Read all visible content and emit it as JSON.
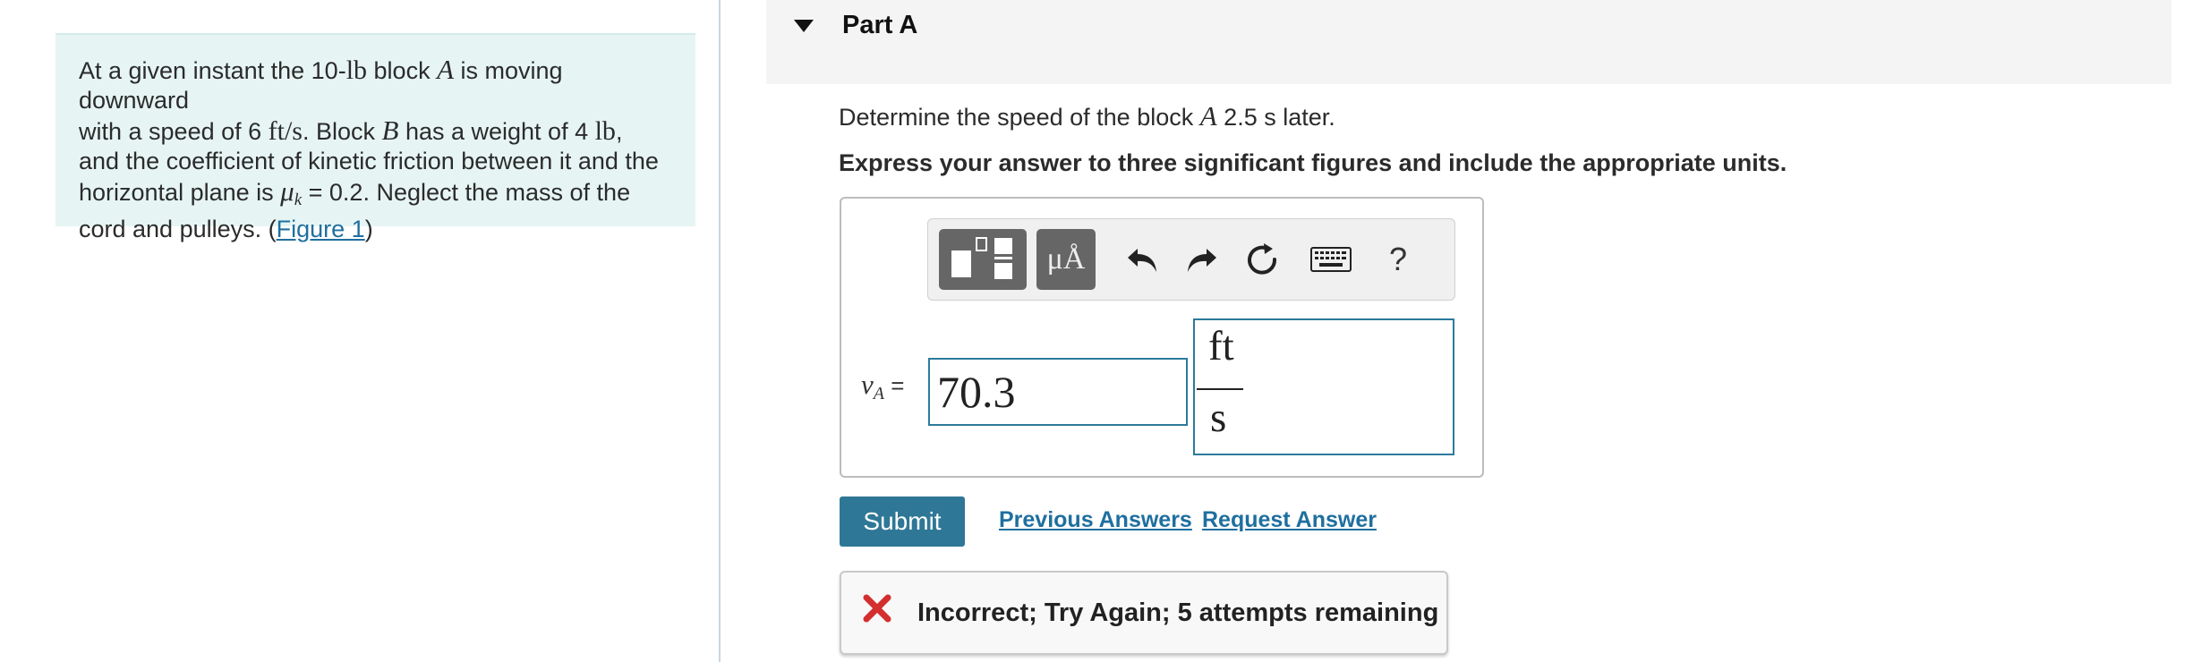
{
  "problem": {
    "t1": "At a given instant the 10-",
    "unit_lb": "lb",
    "t2": " block ",
    "block_a": "A",
    "t3": " is moving downward",
    "t4": "with a speed of 6 ",
    "unit_fts": "ft/s",
    "t5": ". Block ",
    "block_b": "B",
    "t6": " has a weight of 4 ",
    "unit_lb2": "lb",
    "t7": ",",
    "t8": "and the coefficient of kinetic friction between it and the",
    "t9": "horizontal plane is ",
    "mu": "μ",
    "mu_sub": "k",
    "t10": " = 0.2. Neglect the mass of the",
    "t11": "cord and pulleys. (",
    "figure_link": "Figure 1",
    "t12": ")"
  },
  "part": {
    "title": "Part A"
  },
  "question": {
    "q1": "Determine the speed of the block ",
    "block": "A",
    "q2": " 2.5 s  later."
  },
  "instructions": "Express your answer to three significant figures and include the appropriate units.",
  "toolbar": {
    "units_label": "μÅ",
    "help_label": "?"
  },
  "answer": {
    "var": "v",
    "var_sub": "A",
    "equals": " = ",
    "value": "70.3",
    "unit_numerator": "ft",
    "unit_denominator": "s"
  },
  "actions": {
    "submit": "Submit",
    "previous_answers": "Previous Answers",
    "request_answer": "Request Answer"
  },
  "feedback": {
    "text": "Incorrect; Try Again; 5 attempts remaining",
    "color": "#d32f2f"
  }
}
